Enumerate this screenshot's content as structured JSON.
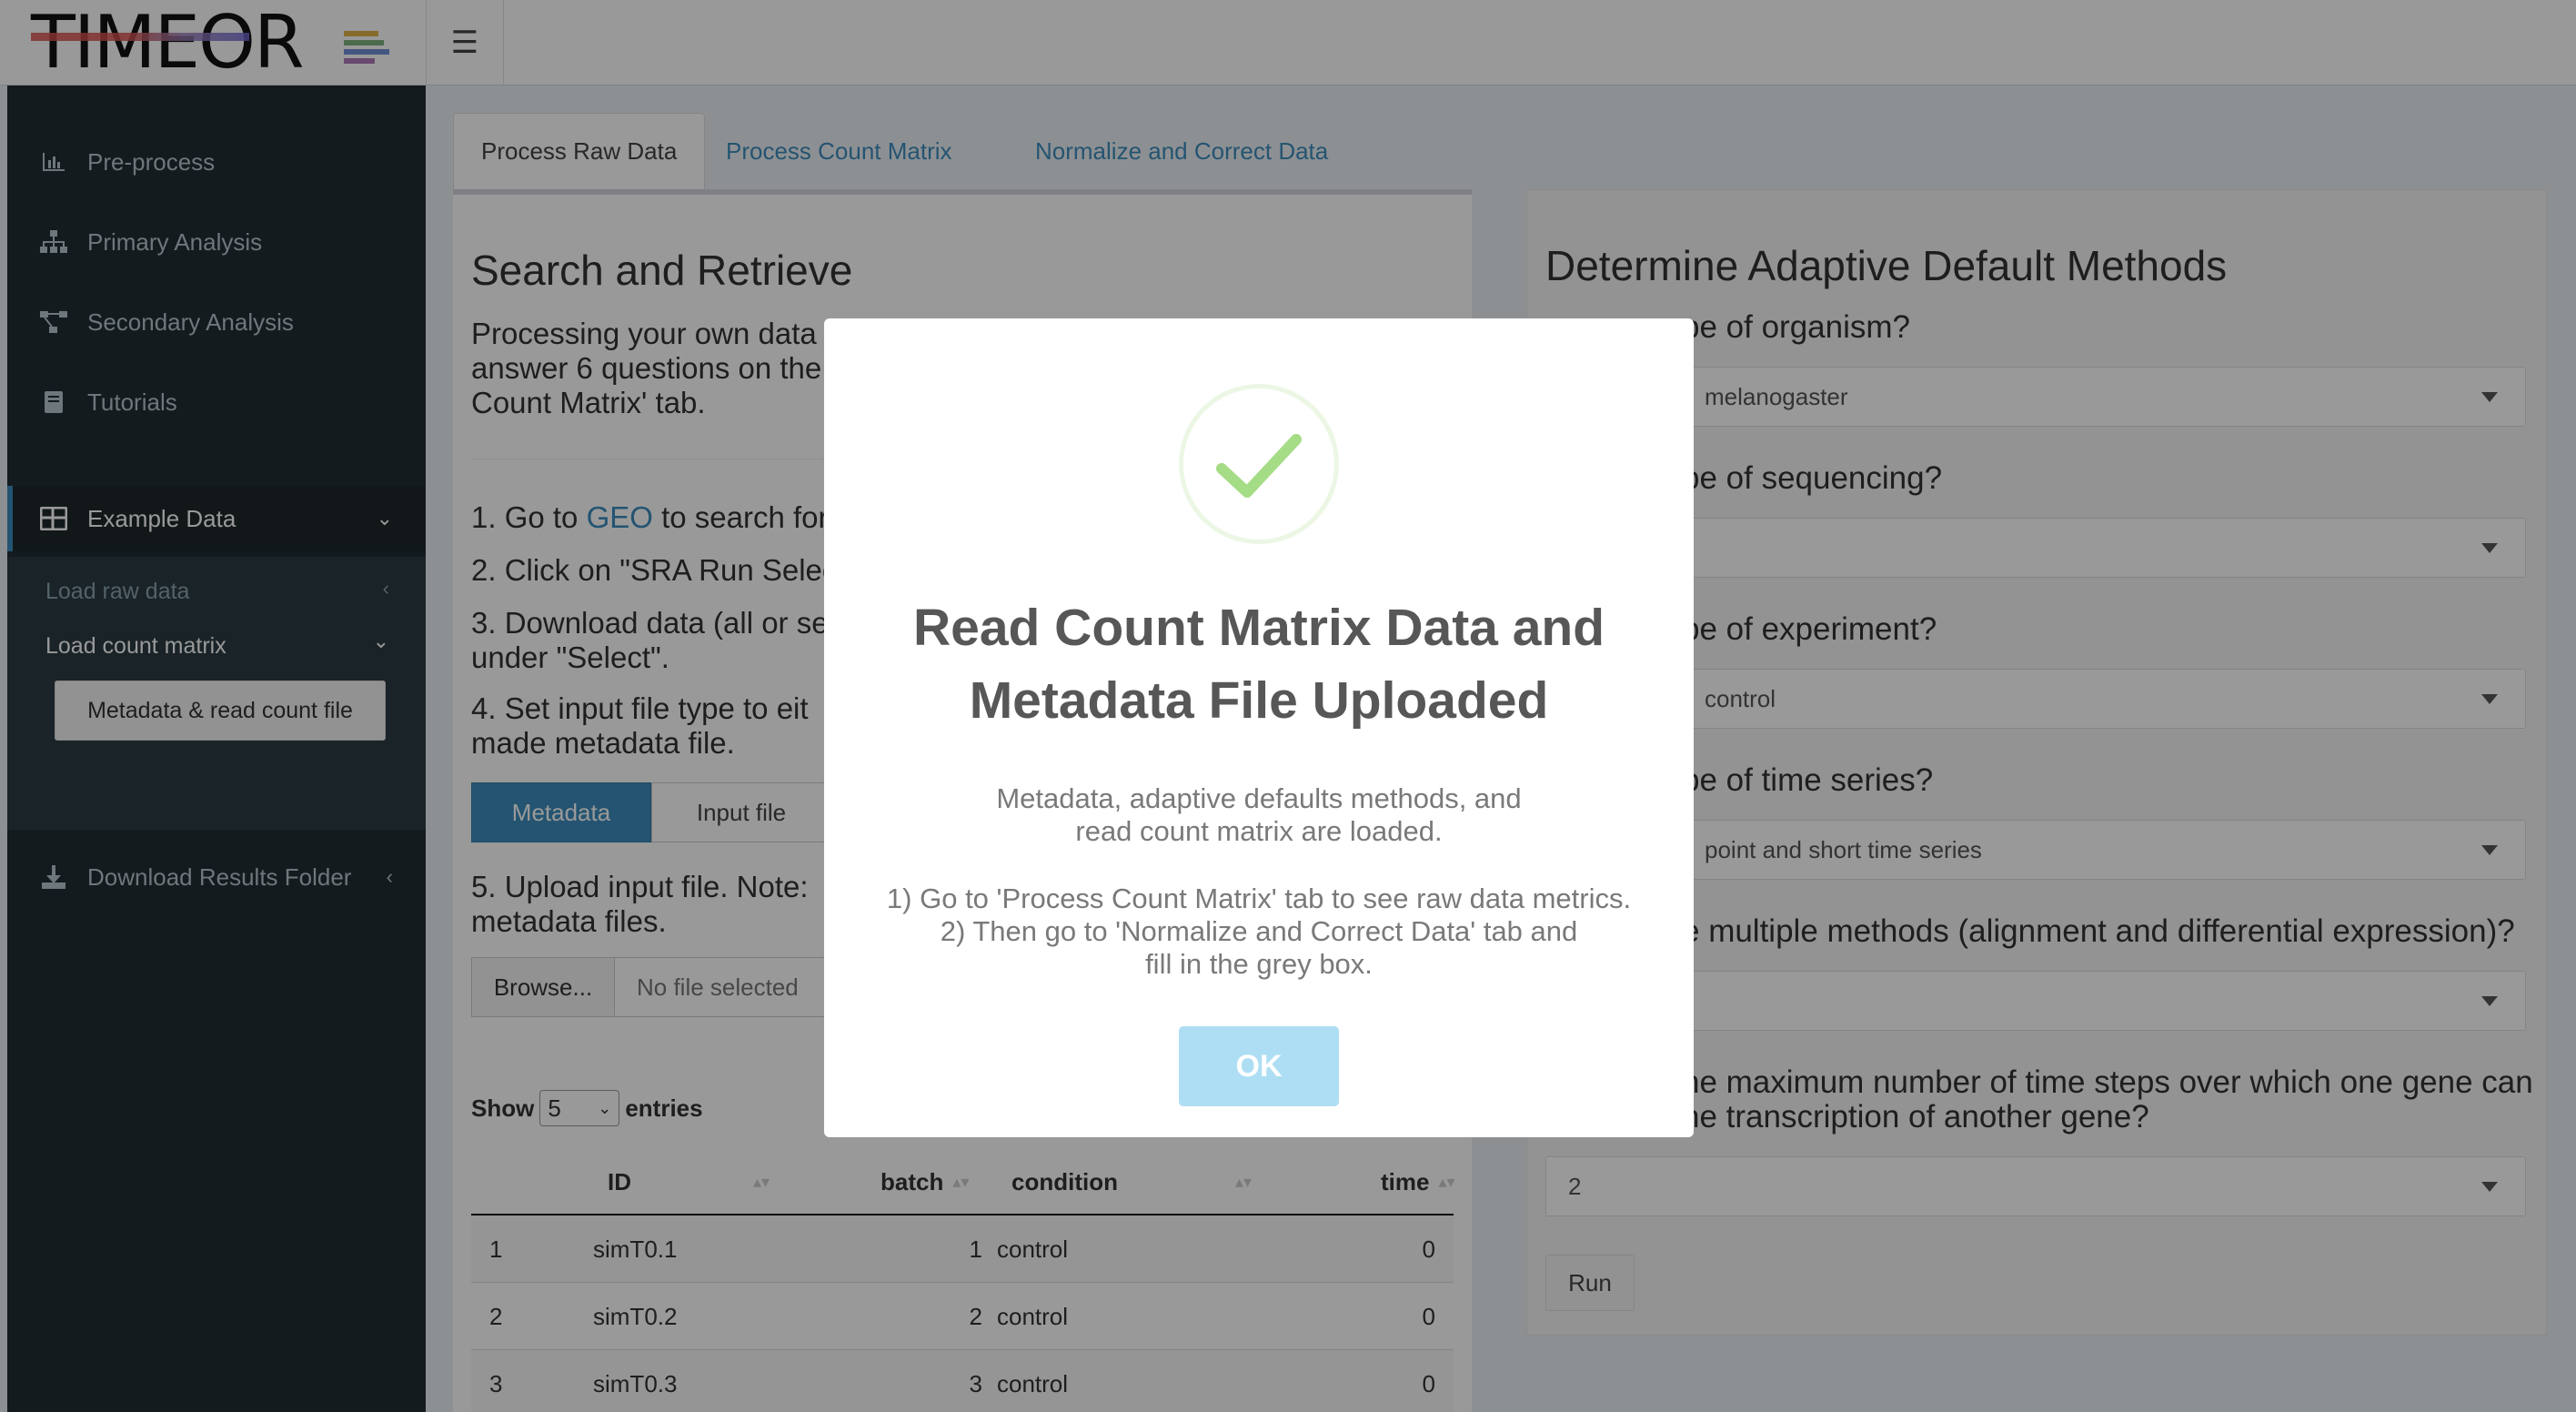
{
  "app": {
    "logo_text": "TIMEOR"
  },
  "sidebar": {
    "items": [
      {
        "label": "Pre-process",
        "icon": "bar-chart-icon"
      },
      {
        "label": "Primary Analysis",
        "icon": "sitemap-icon"
      },
      {
        "label": "Secondary Analysis",
        "icon": "network-icon"
      },
      {
        "label": "Tutorials",
        "icon": "book-icon"
      },
      {
        "label": "Example Data",
        "icon": "table-icon"
      },
      {
        "label": "Download Results Folder",
        "icon": "download-icon"
      }
    ],
    "subitems": [
      {
        "label": "Load raw data"
      },
      {
        "label": "Load count matrix"
      }
    ],
    "sub_button": "Metadata & read count file"
  },
  "tabs": [
    {
      "label": "Process Raw Data",
      "active": true
    },
    {
      "label": "Process Count Matrix",
      "active": false
    },
    {
      "label": "Normalize and Correct Data",
      "active": false
    }
  ],
  "left_panel": {
    "title": "Search and Retrieve",
    "intro": [
      "Processing your own data",
      "answer 6 questions on the",
      "Count Matrix' tab."
    ],
    "step1_prefix": "1. Go to ",
    "step1_link": "GEO",
    "step1_suffix": " to search for",
    "step2": "2. Click on \"SRA Run Selec",
    "step3": [
      "3. Download data (all or se",
      "under \"Select\"."
    ],
    "step4": [
      "4. Set input file type to eit",
      "made metadata file."
    ],
    "segment": {
      "on": "Metadata",
      "off": "Input file"
    },
    "step5": [
      "5. Upload input file. Note:",
      "metadata files."
    ],
    "browse_label": "Browse...",
    "file_placeholder": "No file selected",
    "show_label": "Show",
    "show_value": "5",
    "entries_label": "entries",
    "table": {
      "columns": [
        "",
        "ID",
        "batch",
        "condition",
        "time"
      ],
      "rows": [
        [
          "1",
          "simT0.1",
          "1",
          "control",
          "0"
        ],
        [
          "2",
          "simT0.2",
          "2",
          "control",
          "0"
        ],
        [
          "3",
          "simT0.3",
          "3",
          "control",
          "0"
        ]
      ]
    }
  },
  "right_panel": {
    "title": "Determine Adaptive Default Methods",
    "questions": [
      {
        "label": "pe of organism?",
        "value": "melanogaster"
      },
      {
        "label": "pe of sequencing?",
        "value": ""
      },
      {
        "label": "pe of experiment?",
        "value": "control"
      },
      {
        "label": "pe of time series?",
        "value": "point and short time series"
      },
      {
        "label": "e multiple methods (alignment and differential expression)?",
        "value": ""
      },
      {
        "label": "he maximum number of time steps over which one gene can",
        "label2": "he transcription of another gene?",
        "value": "2"
      }
    ],
    "run_label": "Run"
  },
  "modal": {
    "icon": "checkmark-icon",
    "title_line1": "Read Count Matrix Data and",
    "title_line2": "Metadata File Uploaded",
    "text_line1": "Metadata, adaptive defaults methods, and",
    "text_line2": "read count matrix are loaded.",
    "text_line3": "1) Go to 'Process Count Matrix' tab to see raw data metrics.",
    "text_line4": "2) Then go to 'Normalize and Correct Data' tab and",
    "text_line5": "fill in the grey box.",
    "ok_label": "OK"
  },
  "colors": {
    "sidebar_bg": "#222d32",
    "accent": "#3c8dbc",
    "ok_button": "#aedef4",
    "check": "#a5dc86"
  }
}
